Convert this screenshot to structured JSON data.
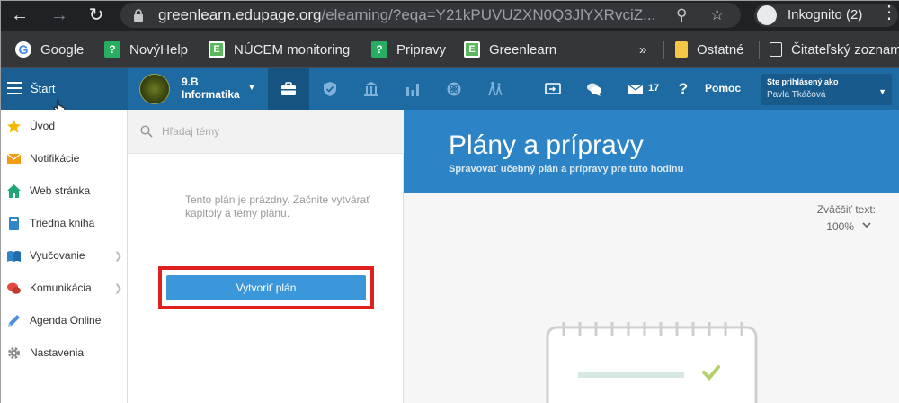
{
  "browser": {
    "url_domain": "greenlearn.edupage.org",
    "url_path": "/elearning/?eqa=Y21kPUVUZXN0Q3JlYXRvciZ...",
    "incognito_label": "Inkognito (2)",
    "bookmarks": [
      {
        "label": "Google",
        "icon": "google-icon"
      },
      {
        "label": "NovýHelp",
        "icon": "question-icon"
      },
      {
        "label": "NÚCEM monitoring",
        "icon": "e-icon"
      },
      {
        "label": "Pripravy",
        "icon": "question-icon"
      },
      {
        "label": "Greenlearn",
        "icon": "e-icon"
      }
    ],
    "more_bookmarks": "»",
    "other_folder": "Ostatné",
    "reading_list": "Čitateľský zoznam"
  },
  "header": {
    "start_label": "Štart",
    "class_line1": "9.B",
    "class_line2": "Informatika",
    "messages_count": "17",
    "help_label": "Pomoc",
    "logged_in_label": "Ste prihlásený ako",
    "user_name": "Pavla Tkáčová"
  },
  "sidebar": {
    "items": [
      {
        "label": "Úvod",
        "icon": "star-icon"
      },
      {
        "label": "Notifikácie",
        "icon": "envelope-icon"
      },
      {
        "label": "Web stránka",
        "icon": "house-icon"
      },
      {
        "label": "Triedna kniha",
        "icon": "book-icon"
      },
      {
        "label": "Vyučovanie",
        "icon": "open-book-icon"
      },
      {
        "label": "Komunikácia",
        "icon": "chat-icon"
      },
      {
        "label": "Agenda Online",
        "icon": "pencil-icon"
      },
      {
        "label": "Nastavenia",
        "icon": "gear-icon"
      }
    ]
  },
  "plan": {
    "search_placeholder": "Hľadaj témy",
    "empty_line1": "Tento plán je prázdny. Začnite vytvárať",
    "empty_line2": "kapitoly a témy plánu.",
    "create_button": "Vytvoriť plán"
  },
  "content": {
    "title": "Plány a prípravy",
    "subtitle": "Spravovať učebný plán a prípravy pre túto hodinu",
    "zoom_label": "Zväčšiť text:",
    "zoom_value": "100%"
  },
  "colors": {
    "header_blue": "#1e6aa2",
    "banner_blue": "#2c83c6",
    "button_blue": "#3b96da",
    "highlight_red": "#e0201c"
  }
}
